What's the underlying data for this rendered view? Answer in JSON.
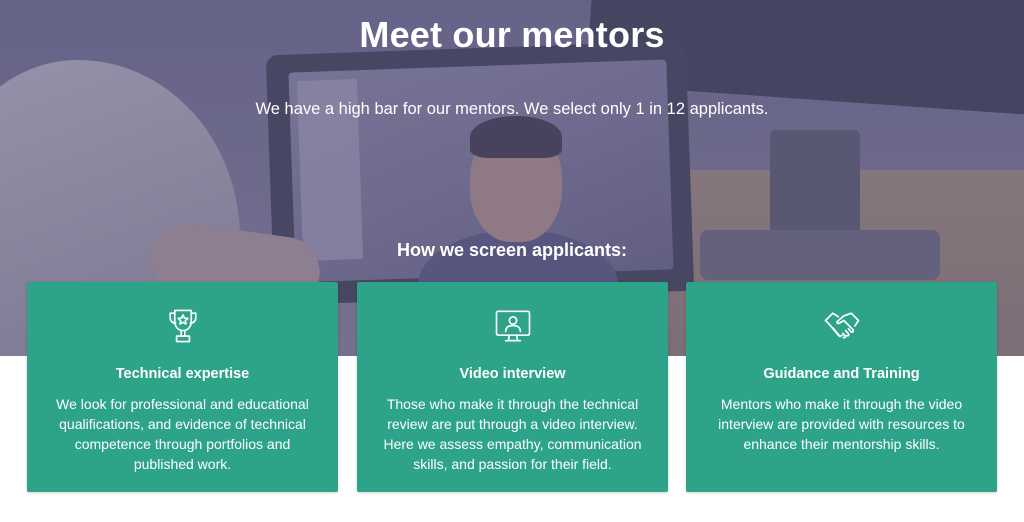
{
  "hero": {
    "title": "Meet our mentors",
    "subtitle": "We have a high bar for our mentors. We select only 1 in 12 applicants.",
    "screen_heading": "How we screen applicants:"
  },
  "cards": [
    {
      "icon": "trophy-icon",
      "title": "Technical expertise",
      "text": "We look for professional and educational qualifications, and evidence of technical competence through portfolios and published work."
    },
    {
      "icon": "video-call-icon",
      "title": "Video interview",
      "text": "Those who make it through the technical review are put through a video interview. Here we assess empathy, communication skills, and passion for their field."
    },
    {
      "icon": "handshake-icon",
      "title": "Guidance and Training",
      "text": "Mentors who make it through the video interview are provided with resources to enhance their mentorship skills."
    }
  ],
  "colors": {
    "card_background": "#2da38a",
    "text_on_dark": "#ffffff",
    "page_background": "#ffffff"
  }
}
